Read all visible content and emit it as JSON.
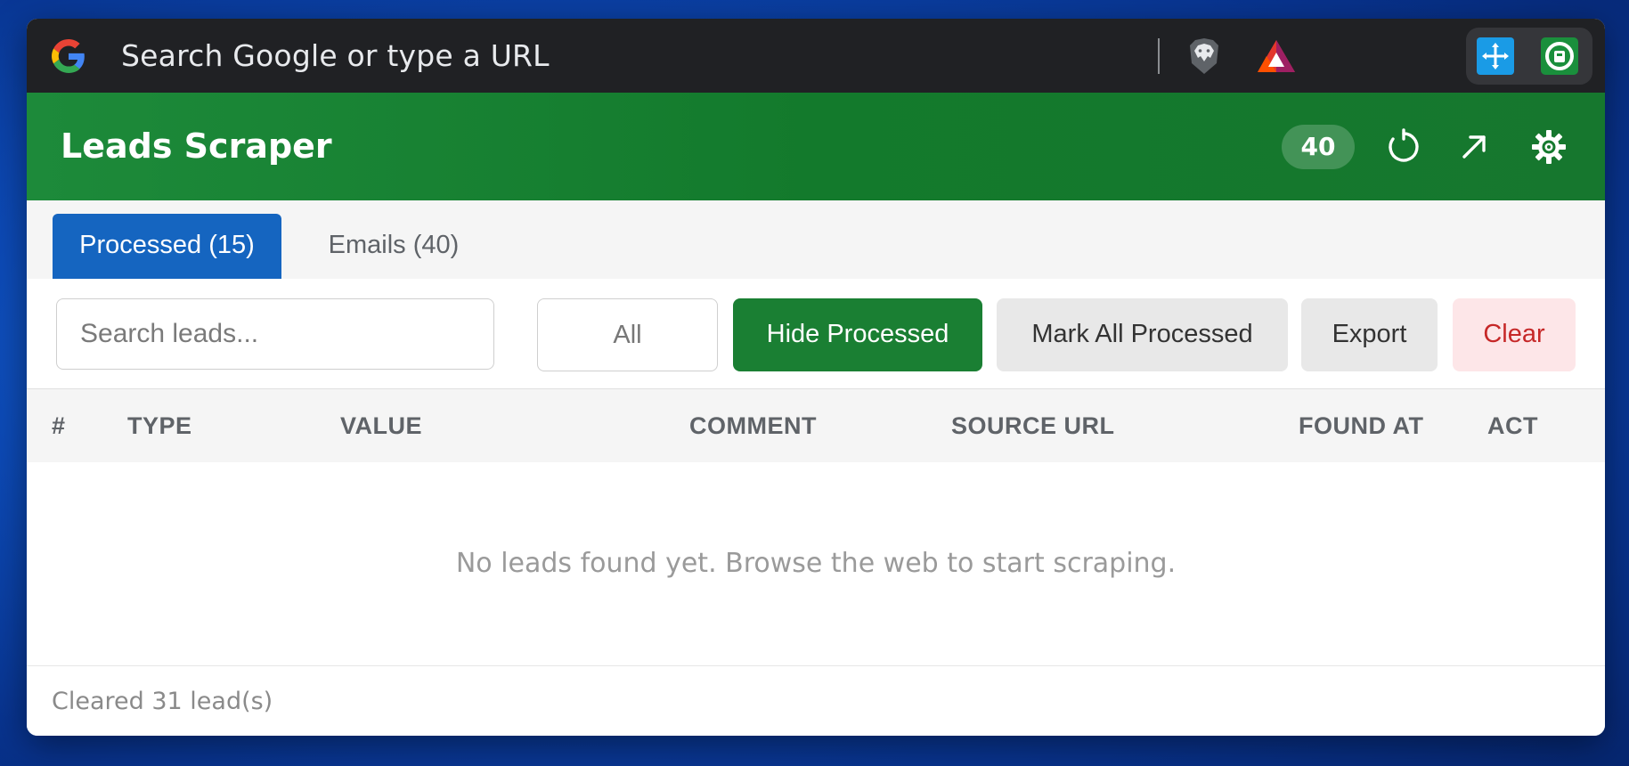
{
  "browser": {
    "omnibox_placeholder": "Search Google or type a URL",
    "icons": [
      "google-g-icon",
      "brave-shield-icon",
      "bat-rewards-icon",
      "move-extension-icon",
      "scraper-extension-icon"
    ]
  },
  "header": {
    "title": "Leads Scraper",
    "count_badge": "40",
    "icons": [
      "refresh-icon",
      "open-external-icon",
      "gear-icon"
    ],
    "color": "#1a7f33"
  },
  "tabs": [
    {
      "label": "Processed (15)",
      "active": true
    },
    {
      "label": "Emails (40)",
      "active": false
    }
  ],
  "toolbar": {
    "search_placeholder": "Search leads...",
    "filter_label": "All",
    "hide_processed_label": "Hide Processed",
    "mark_all_label": "Mark All Processed",
    "export_label": "Export",
    "clear_label": "Clear"
  },
  "table": {
    "columns": [
      "#",
      "TYPE",
      "VALUE",
      "COMMENT",
      "SOURCE URL",
      "FOUND AT",
      "ACT"
    ],
    "rows": [],
    "empty_message": "No leads found yet. Browse the web to start scraping."
  },
  "footer": {
    "status": "Cleared 31 lead(s)"
  },
  "colors": {
    "accent_blue": "#1565c0",
    "accent_green": "#1a7f33",
    "danger_red": "#c62828"
  }
}
